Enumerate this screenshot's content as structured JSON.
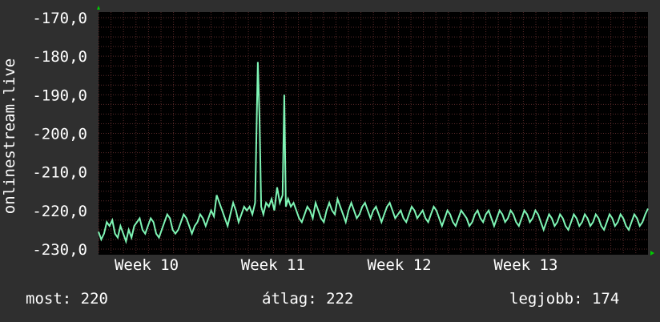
{
  "chart_data": {
    "type": "line",
    "ylabel": "onlinestream.live",
    "ylim": [
      -230,
      -170
    ],
    "y_ticks": [
      "-170,0",
      "-180,0",
      "-190,0",
      "-200,0",
      "-210,0",
      "-220,0",
      "-230,0"
    ],
    "y_tick_values": [
      -170,
      -180,
      -190,
      -200,
      -210,
      -220,
      -230
    ],
    "x_ticks": [
      "Week 10",
      "Week 11",
      "Week 12",
      "Week 13"
    ],
    "x_tick_positions": [
      8.75,
      31.75,
      54.75,
      77.75
    ],
    "xlim": [
      0,
      100
    ],
    "grid": true,
    "colors": {
      "line": "#7ff5b5",
      "background": "#000000",
      "grid": "#5a2a2a",
      "axis_arrow": "#00cc00"
    },
    "series": [
      {
        "values": [
          [
            0,
            -225.5
          ],
          [
            0.5,
            -227.5
          ],
          [
            1,
            -226
          ],
          [
            1.5,
            -223
          ],
          [
            2,
            -224
          ],
          [
            2.5,
            -222.5
          ],
          [
            3,
            -226
          ],
          [
            3.5,
            -227
          ],
          [
            4,
            -224
          ],
          [
            4.5,
            -226
          ],
          [
            5,
            -228
          ],
          [
            5.5,
            -225
          ],
          [
            6,
            -227
          ],
          [
            6.5,
            -224
          ],
          [
            7,
            -223
          ],
          [
            7.5,
            -222
          ],
          [
            8,
            -225
          ],
          [
            8.5,
            -226
          ],
          [
            9,
            -224
          ],
          [
            9.5,
            -222
          ],
          [
            10,
            -223
          ],
          [
            10.5,
            -226
          ],
          [
            11,
            -227
          ],
          [
            11.5,
            -225
          ],
          [
            12,
            -223
          ],
          [
            12.5,
            -221
          ],
          [
            13,
            -222
          ],
          [
            13.5,
            -225
          ],
          [
            14,
            -226
          ],
          [
            14.5,
            -225
          ],
          [
            15,
            -223
          ],
          [
            15.5,
            -221
          ],
          [
            16,
            -222
          ],
          [
            16.5,
            -224
          ],
          [
            17,
            -226
          ],
          [
            17.5,
            -224
          ],
          [
            18,
            -223
          ],
          [
            18.5,
            -221
          ],
          [
            19,
            -222
          ],
          [
            19.5,
            -224
          ],
          [
            20,
            -222
          ],
          [
            20.5,
            -220
          ],
          [
            21,
            -221.5
          ],
          [
            21.5,
            -216
          ],
          [
            22,
            -218
          ],
          [
            22.5,
            -220
          ],
          [
            23,
            -222
          ],
          [
            23.5,
            -224
          ],
          [
            24,
            -221
          ],
          [
            24.5,
            -218
          ],
          [
            25,
            -220
          ],
          [
            25.5,
            -223
          ],
          [
            26,
            -221
          ],
          [
            26.5,
            -219
          ],
          [
            27,
            -220
          ],
          [
            27.5,
            -219
          ],
          [
            28,
            -221
          ],
          [
            28.5,
            -218
          ],
          [
            29,
            -181.5
          ],
          [
            29.3,
            -196
          ],
          [
            29.6,
            -219
          ],
          [
            30,
            -221
          ],
          [
            30.5,
            -218
          ],
          [
            31,
            -219
          ],
          [
            31.5,
            -217
          ],
          [
            32,
            -220
          ],
          [
            32.5,
            -214
          ],
          [
            33,
            -218
          ],
          [
            33.5,
            -216
          ],
          [
            33.8,
            -190
          ],
          [
            34.1,
            -219
          ],
          [
            34.5,
            -217
          ],
          [
            35,
            -219
          ],
          [
            35.5,
            -218
          ],
          [
            36,
            -220
          ],
          [
            36.5,
            -222
          ],
          [
            37,
            -223
          ],
          [
            37.5,
            -221
          ],
          [
            38,
            -219
          ],
          [
            38.5,
            -220
          ],
          [
            39,
            -222
          ],
          [
            39.5,
            -218
          ],
          [
            40,
            -220
          ],
          [
            40.5,
            -222
          ],
          [
            41,
            -223
          ],
          [
            41.5,
            -220
          ],
          [
            42,
            -218
          ],
          [
            42.5,
            -220
          ],
          [
            43,
            -221
          ],
          [
            43.5,
            -217
          ],
          [
            44,
            -219
          ],
          [
            44.5,
            -221
          ],
          [
            45,
            -223
          ],
          [
            45.5,
            -220
          ],
          [
            46,
            -218
          ],
          [
            46.5,
            -220
          ],
          [
            47,
            -222
          ],
          [
            47.5,
            -221
          ],
          [
            48,
            -219
          ],
          [
            48.5,
            -218
          ],
          [
            49,
            -220
          ],
          [
            49.5,
            -222
          ],
          [
            50,
            -220
          ],
          [
            50.5,
            -219
          ],
          [
            51,
            -221
          ],
          [
            51.5,
            -223
          ],
          [
            52,
            -221
          ],
          [
            52.5,
            -219
          ],
          [
            53,
            -218
          ],
          [
            53.5,
            -220
          ],
          [
            54,
            -222
          ],
          [
            54.5,
            -221
          ],
          [
            55,
            -220
          ],
          [
            55.5,
            -222
          ],
          [
            56,
            -223
          ],
          [
            56.5,
            -221
          ],
          [
            57,
            -219
          ],
          [
            57.5,
            -220
          ],
          [
            58,
            -222
          ],
          [
            58.5,
            -221
          ],
          [
            59,
            -220
          ],
          [
            59.5,
            -222
          ],
          [
            60,
            -223
          ],
          [
            60.5,
            -221
          ],
          [
            61,
            -219
          ],
          [
            61.5,
            -220
          ],
          [
            62,
            -222
          ],
          [
            62.5,
            -224
          ],
          [
            63,
            -222
          ],
          [
            63.5,
            -220
          ],
          [
            64,
            -221
          ],
          [
            64.5,
            -223
          ],
          [
            65,
            -224
          ],
          [
            65.5,
            -222
          ],
          [
            66,
            -220
          ],
          [
            66.5,
            -221
          ],
          [
            67,
            -222
          ],
          [
            67.5,
            -224
          ],
          [
            68,
            -223
          ],
          [
            68.5,
            -221
          ],
          [
            69,
            -220
          ],
          [
            69.5,
            -222
          ],
          [
            70,
            -223
          ],
          [
            70.5,
            -221
          ],
          [
            71,
            -220
          ],
          [
            71.5,
            -222
          ],
          [
            72,
            -224
          ],
          [
            72.5,
            -222
          ],
          [
            73,
            -220
          ],
          [
            73.5,
            -221
          ],
          [
            74,
            -223
          ],
          [
            74.5,
            -222
          ],
          [
            75,
            -220
          ],
          [
            75.5,
            -221
          ],
          [
            76,
            -223
          ],
          [
            76.5,
            -224
          ],
          [
            77,
            -222
          ],
          [
            77.5,
            -220
          ],
          [
            78,
            -221
          ],
          [
            78.5,
            -223
          ],
          [
            79,
            -222
          ],
          [
            79.5,
            -220
          ],
          [
            80,
            -221
          ],
          [
            80.5,
            -223
          ],
          [
            81,
            -225
          ],
          [
            81.5,
            -223
          ],
          [
            82,
            -221
          ],
          [
            82.5,
            -222
          ],
          [
            83,
            -224
          ],
          [
            83.5,
            -223
          ],
          [
            84,
            -221
          ],
          [
            84.5,
            -222
          ],
          [
            85,
            -224
          ],
          [
            85.5,
            -225
          ],
          [
            86,
            -223
          ],
          [
            86.5,
            -221
          ],
          [
            87,
            -222
          ],
          [
            87.5,
            -224
          ],
          [
            88,
            -223
          ],
          [
            88.5,
            -221
          ],
          [
            89,
            -222
          ],
          [
            89.5,
            -224
          ],
          [
            90,
            -223
          ],
          [
            90.5,
            -221
          ],
          [
            91,
            -222
          ],
          [
            91.5,
            -224
          ],
          [
            92,
            -225
          ],
          [
            92.5,
            -223
          ],
          [
            93,
            -221
          ],
          [
            93.5,
            -222
          ],
          [
            94,
            -224
          ],
          [
            94.5,
            -223
          ],
          [
            95,
            -221
          ],
          [
            95.5,
            -222
          ],
          [
            96,
            -224
          ],
          [
            96.5,
            -225
          ],
          [
            97,
            -223
          ],
          [
            97.5,
            -221
          ],
          [
            98,
            -222
          ],
          [
            98.5,
            -224
          ],
          [
            99,
            -223
          ],
          [
            99.5,
            -221
          ],
          [
            100,
            -219.5
          ]
        ]
      }
    ]
  },
  "stats": {
    "now": "most: 220",
    "avg": "átlag: 222",
    "best": "legjobb: 174"
  }
}
